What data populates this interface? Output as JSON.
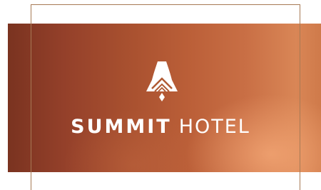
{
  "brand": {
    "name_bold": "SUMMIT",
    "name_light": "HOTEL",
    "logo_icon": "bell-mountain-icon"
  },
  "colors": {
    "frame": "#a77a55",
    "background_dark": "#7a3320",
    "background_light": "#f6aa78",
    "text": "#ffffff"
  }
}
